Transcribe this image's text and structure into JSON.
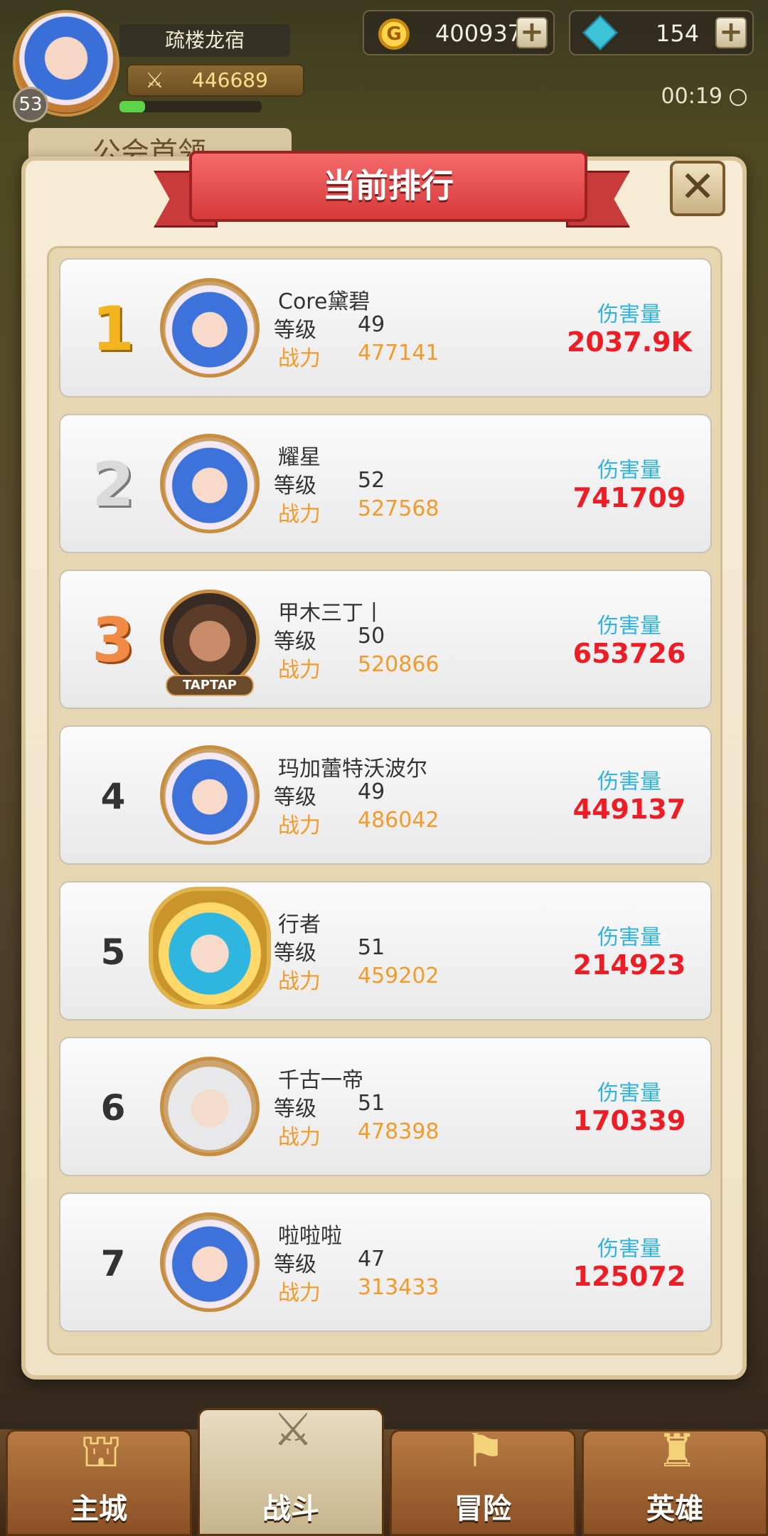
{
  "player": {
    "name": "疏楼龙宿",
    "level": "53",
    "power": "446689",
    "exp_fraction": 0.18
  },
  "resources": {
    "gold": "400937",
    "gems": "154",
    "plus_symbol": "+"
  },
  "timer": "00:19",
  "background_tab": "公会首领",
  "modal": {
    "title": "当前排行",
    "close_symbol": "✕",
    "level_label": "等级",
    "power_label": "战力",
    "damage_label": "伤害量"
  },
  "rankings": [
    {
      "rank": "1",
      "name": "Core黛碧",
      "level": "49",
      "power": "477141",
      "damage": "2037.9K"
    },
    {
      "rank": "2",
      "name": "耀星",
      "level": "52",
      "power": "527568",
      "damage": "741709"
    },
    {
      "rank": "3",
      "name": "甲木三丁丨",
      "level": "50",
      "power": "520866",
      "damage": "653726",
      "tag": "TAPTAP"
    },
    {
      "rank": "4",
      "name": "玛加蕾特沃波尔",
      "level": "49",
      "power": "486042",
      "damage": "449137"
    },
    {
      "rank": "5",
      "name": "行者",
      "level": "51",
      "power": "459202",
      "damage": "214923"
    },
    {
      "rank": "6",
      "name": "千古一帝",
      "level": "51",
      "power": "478398",
      "damage": "170339"
    },
    {
      "rank": "7",
      "name": "啦啦啦",
      "level": "47",
      "power": "313433",
      "damage": "125072"
    }
  ],
  "nav": [
    {
      "label": "主城",
      "icon": "city-icon"
    },
    {
      "label": "战斗",
      "icon": "crossed-swords-icon"
    },
    {
      "label": "冒险",
      "icon": "adventure-icon"
    },
    {
      "label": "英雄",
      "icon": "hero-icon"
    }
  ]
}
